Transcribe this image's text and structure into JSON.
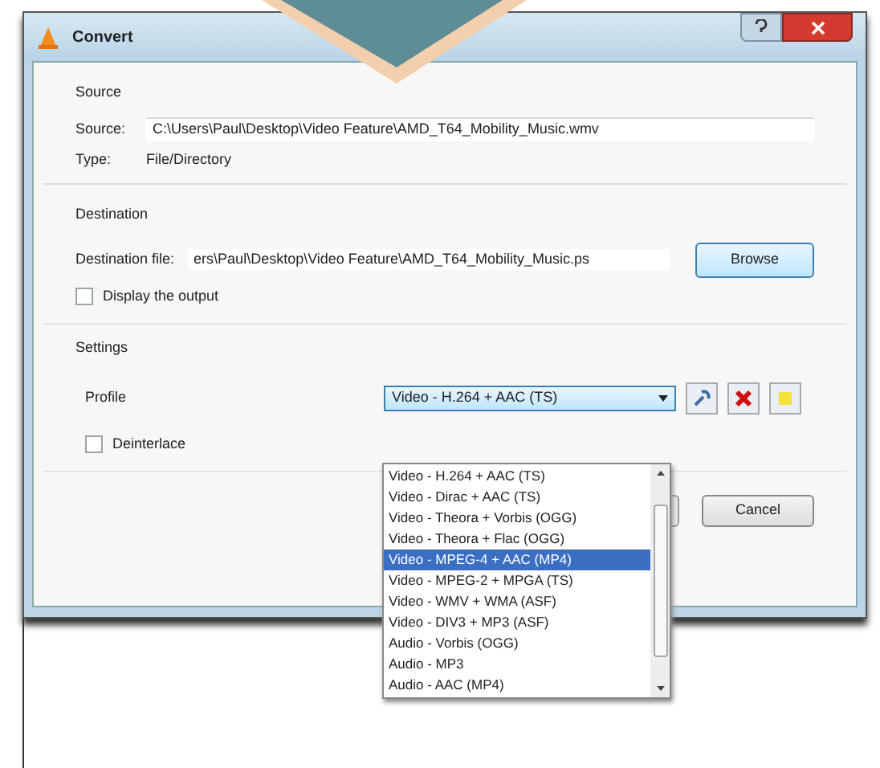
{
  "window": {
    "title": "Convert"
  },
  "source": {
    "heading": "Source",
    "source_label": "Source:",
    "source_value": "C:\\Users\\Paul\\Desktop\\Video Feature\\AMD_T64_Mobility_Music.wmv",
    "type_label": "Type:",
    "type_value": "File/Directory"
  },
  "destination": {
    "heading": "Destination",
    "file_label": "Destination file:",
    "file_value": "ers\\Paul\\Desktop\\Video Feature\\AMD_T64_Mobility_Music.ps",
    "browse_button": "Browse",
    "display_output": {
      "label": "Display the output",
      "checked": false
    }
  },
  "settings": {
    "heading": "Settings",
    "profile_label": "Profile",
    "profile_value": "Video - H.264 + AAC (TS)",
    "deinterlace": {
      "label": "Deinterlace",
      "checked": false
    }
  },
  "profile_list": [
    {
      "label": "Video - H.264 + AAC (TS)",
      "selected": false
    },
    {
      "label": "Video - Dirac + AAC (TS)",
      "selected": false
    },
    {
      "label": "Video - Theora + Vorbis (OGG)",
      "selected": false
    },
    {
      "label": "Video - Theora + Flac (OGG)",
      "selected": false
    },
    {
      "label": "Video - MPEG-4 + AAC (MP4)",
      "selected": true
    },
    {
      "label": "Video - MPEG-2 + MPGA (TS)",
      "selected": false
    },
    {
      "label": "Video - WMV + WMA (ASF)",
      "selected": false
    },
    {
      "label": "Video - DIV3 + MP3 (ASF)",
      "selected": false
    },
    {
      "label": "Audio - Vorbis (OGG)",
      "selected": false
    },
    {
      "label": "Audio - MP3",
      "selected": false
    },
    {
      "label": "Audio - AAC (MP4)",
      "selected": false
    }
  ],
  "buttons": {
    "cancel": "Cancel"
  }
}
